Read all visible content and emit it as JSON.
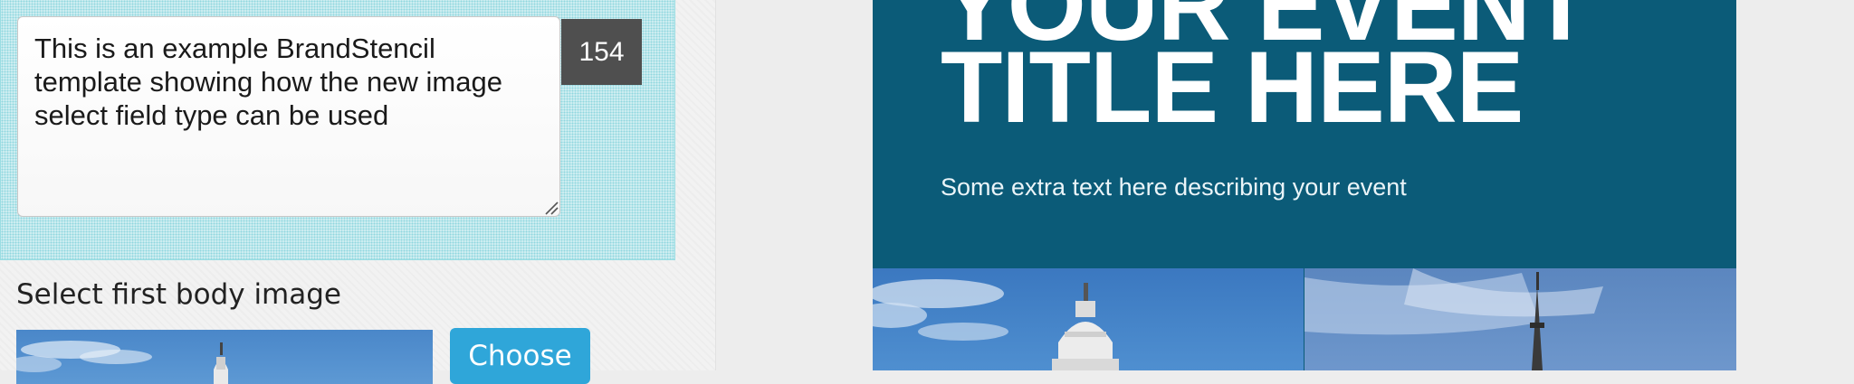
{
  "editor": {
    "body_text": "This is an example BrandStencil template showing how the new image select field type can be used",
    "char_count": "154",
    "select_label": "Select first body image",
    "choose_label": "Choose"
  },
  "preview": {
    "title_line1": "YOUR EVENT",
    "title_line2": "TITLE HERE",
    "subtitle": "Some extra text here describing your event"
  },
  "colors": {
    "poster_bg": "#0b5b78",
    "accent": "#2fa6d9",
    "field_highlight": "#cfeef1",
    "counter_bg": "#4f4f4f"
  },
  "icons": [
    "resize-grip-icon",
    "capitol-dome-image",
    "church-spire-image"
  ]
}
